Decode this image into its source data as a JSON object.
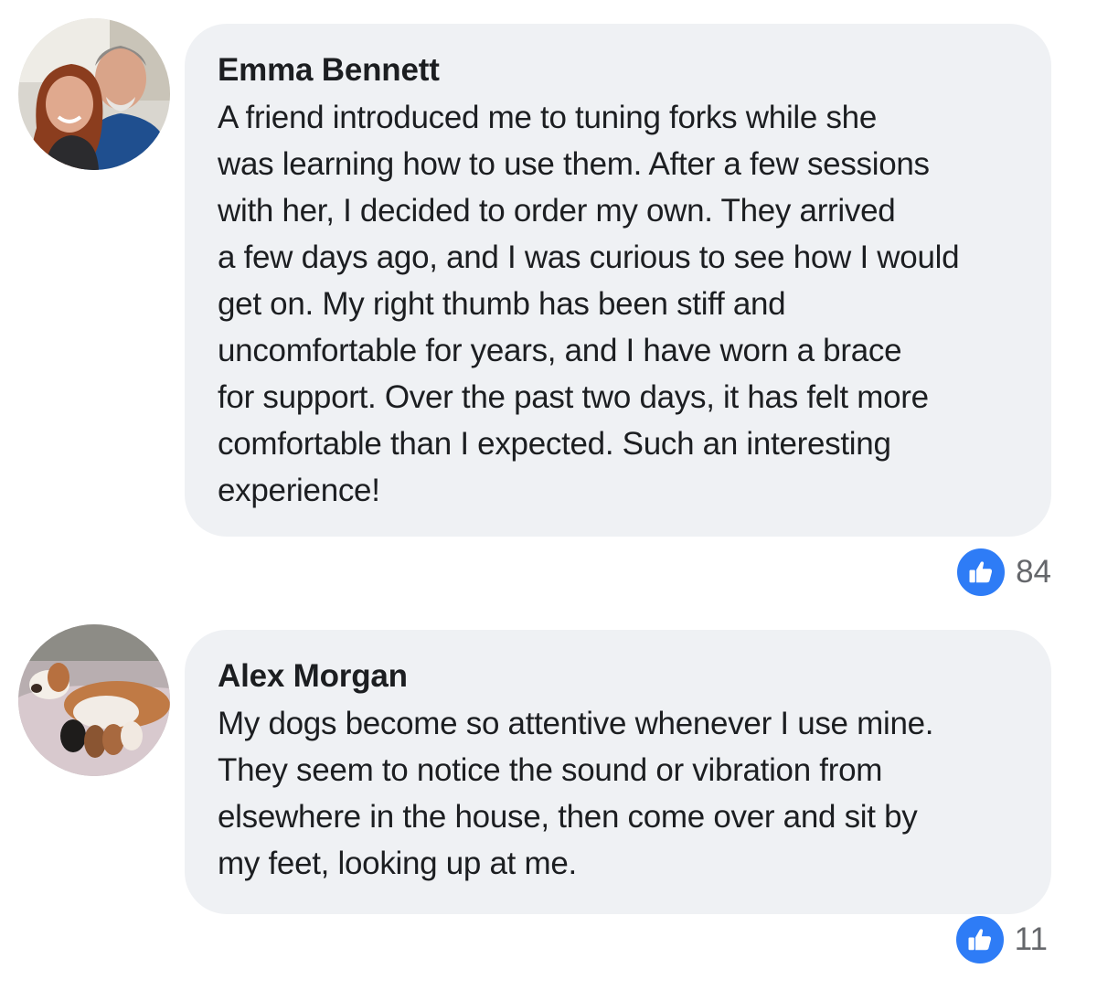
{
  "comments": [
    {
      "author": "Emma Bennett",
      "avatar_icon": "avatar-photo-couple",
      "lines": [
        "A friend introduced me to tuning forks while she",
        "was learning how to use them. After a few sessions",
        "with her, I decided to order my own. They arrived",
        "a few days ago, and I was curious to see how I would",
        "get on. My right thumb has been stiff and",
        "uncomfortable for years, and I have worn a brace",
        "for support. Over the past two days, it has felt more",
        "comfortable than I expected. Such an interesting",
        "experience!"
      ],
      "reaction_icon": "thumbs-up-icon",
      "like_count": "84"
    },
    {
      "author": "Alex Morgan",
      "avatar_icon": "avatar-photo-dog-with-puppies",
      "lines": [
        "My dogs become so attentive whenever I use mine.",
        "They seem to notice the sound or vibration from",
        "elsewhere in the house, then come over and sit by",
        "my feet, looking up at me."
      ],
      "reaction_icon": "thumbs-up-icon",
      "like_count": "11"
    }
  ],
  "colors": {
    "bubble_background": "#eff1f4",
    "like_blue": "#2e7cf6",
    "count_gray": "#65676b",
    "text": "#1c1e21"
  }
}
